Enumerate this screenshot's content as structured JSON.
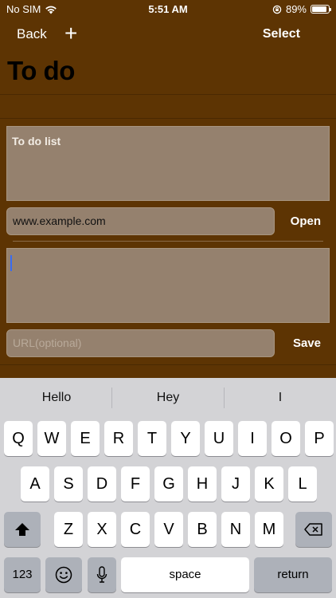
{
  "status": {
    "carrier": "No SIM",
    "time": "5:51 AM",
    "battery": "89%",
    "battery_level": 0.89
  },
  "nav": {
    "back": "Back",
    "plus": "+",
    "select": "Select",
    "title": "To do"
  },
  "form": {
    "list_title": "To do list",
    "url_value": "www.example.com",
    "open_label": "Open",
    "note_value": "",
    "url_placeholder": "URL(optional)",
    "save_label": "Save"
  },
  "keyboard": {
    "suggestions": [
      "Hello",
      "Hey",
      "I"
    ],
    "row1": [
      "Q",
      "W",
      "E",
      "R",
      "T",
      "Y",
      "U",
      "I",
      "O",
      "P"
    ],
    "row2": [
      "A",
      "S",
      "D",
      "F",
      "G",
      "H",
      "J",
      "K",
      "L"
    ],
    "row3": [
      "Z",
      "X",
      "C",
      "V",
      "B",
      "N",
      "M"
    ],
    "numbers_label": "123",
    "space_label": "space",
    "return_label": "return"
  },
  "colors": {
    "background": "#5d3403",
    "field": "#95816e",
    "cursor": "#3a6cf0",
    "keyboard": "#d3d3d6"
  }
}
